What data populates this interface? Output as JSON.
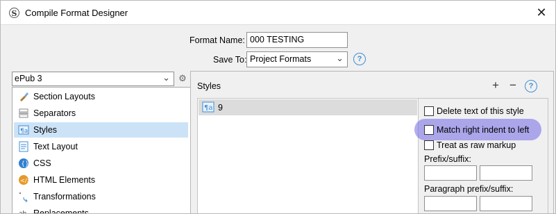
{
  "window": {
    "title": "Compile Format Designer",
    "close_glyph": "✕"
  },
  "format": {
    "name_label": "Format Name:",
    "name_value": "000 TESTING",
    "save_to_label": "Save To:",
    "save_to_value": "Project Formats"
  },
  "left": {
    "format_select_value": "ePub 3",
    "items": [
      {
        "label": "Section Layouts",
        "icon": "brush-icon"
      },
      {
        "label": "Separators",
        "icon": "separator-icon"
      },
      {
        "label": "Styles",
        "icon": "paragraph-style-icon",
        "selected": true
      },
      {
        "label": "Text Layout",
        "icon": "text-layout-icon"
      },
      {
        "label": "CSS",
        "icon": "css-icon"
      },
      {
        "label": "HTML Elements",
        "icon": "html-elements-icon"
      },
      {
        "label": "Transformations",
        "icon": "transformations-icon"
      },
      {
        "label": "Replacements",
        "icon": "replacements-icon"
      }
    ]
  },
  "styles_panel": {
    "title": "Styles",
    "rows": [
      {
        "label": "9"
      }
    ],
    "add_glyph": "+",
    "remove_glyph": "−",
    "help_glyph": "?"
  },
  "options": {
    "delete_text": "Delete text of this style",
    "match_indent": "Match right indent to left",
    "raw_markup": "Treat as raw markup",
    "prefix_suffix": "Prefix/suffix:",
    "paragraph_prefix_suffix": "Paragraph prefix/suffix:"
  },
  "colors": {
    "accent": "#3d8ed6",
    "selection": "#cce3f7",
    "highlight": "#7369e6"
  }
}
